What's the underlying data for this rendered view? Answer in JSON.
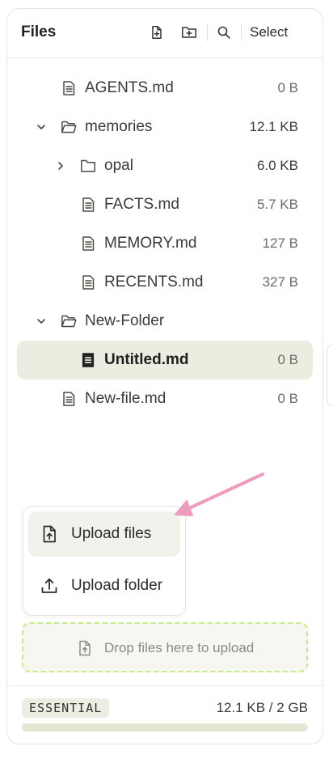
{
  "header": {
    "title": "Files",
    "select_label": "Select"
  },
  "tree": [
    {
      "name": "AGENTS.md",
      "size": "0 B",
      "kind": "file",
      "depth": 1,
      "bold": false,
      "selected": false,
      "size_strong": false
    },
    {
      "name": "memories",
      "size": "12.1 KB",
      "kind": "folder-open",
      "depth": 1,
      "expanded": true,
      "bold": false,
      "selected": false,
      "size_strong": true
    },
    {
      "name": "opal",
      "size": "6.0 KB",
      "kind": "folder",
      "depth": 2,
      "expanded": false,
      "bold": false,
      "selected": false,
      "size_strong": true
    },
    {
      "name": "FACTS.md",
      "size": "5.7 KB",
      "kind": "file",
      "depth": 2,
      "bold": false,
      "selected": false,
      "size_strong": false
    },
    {
      "name": "MEMORY.md",
      "size": "127 B",
      "kind": "file",
      "depth": 2,
      "bold": false,
      "selected": false,
      "size_strong": false
    },
    {
      "name": "RECENTS.md",
      "size": "327 B",
      "kind": "file",
      "depth": 2,
      "bold": false,
      "selected": false,
      "size_strong": false
    },
    {
      "name": "New-Folder",
      "size": "",
      "kind": "folder-open",
      "depth": 1,
      "expanded": true,
      "bold": false,
      "selected": false,
      "size_strong": false
    },
    {
      "name": "Untitled.md",
      "size": "0 B",
      "kind": "file-filled",
      "depth": 2,
      "bold": true,
      "selected": true,
      "size_strong": false
    },
    {
      "name": "New-file.md",
      "size": "0 B",
      "kind": "file",
      "depth": 1,
      "bold": false,
      "selected": false,
      "size_strong": false
    }
  ],
  "upload_menu": {
    "upload_files": "Upload files",
    "upload_folder": "Upload folder"
  },
  "dropzone": {
    "text": "Drop files here to upload"
  },
  "footer": {
    "plan": "ESSENTIAL",
    "usage": "12.1 KB / 2 GB",
    "usage_fraction": 6e-06
  },
  "colors": {
    "selected_row": "#ebede1",
    "dropzone_border": "#c6ec8a",
    "arrow": "#ef9bbd"
  },
  "icons": {
    "new_file": "new-file-icon",
    "new_folder": "new-folder-icon",
    "search": "search-icon",
    "file": "file-text-icon",
    "folder": "folder-icon",
    "folder_open": "folder-open-icon",
    "chevron_down": "chevron-down-icon",
    "chevron_right": "chevron-right-icon",
    "upload_file": "file-upload-icon",
    "upload_folder": "upload-icon"
  }
}
